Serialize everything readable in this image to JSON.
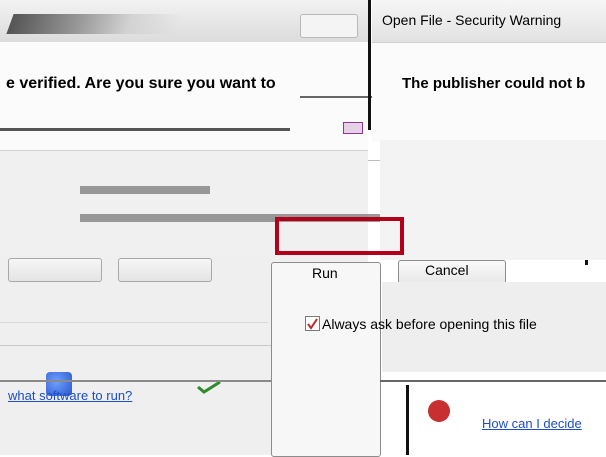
{
  "rear_dialog": {
    "question_text": "e verified.  Are you sure you want to",
    "link_text": "what software to run?"
  },
  "front_dialog": {
    "title": "Open File - Security Warning",
    "heading": "The publisher could not b",
    "checkbox": {
      "label": "Always ask before opening this file",
      "checked": true
    },
    "link_text": "How can I decide"
  },
  "buttons": {
    "run_label": "Run",
    "cancel_label": "Cancel"
  },
  "colors": {
    "highlight": "#b3001b",
    "link": "#1d4ec7",
    "check": "#c0282e"
  }
}
